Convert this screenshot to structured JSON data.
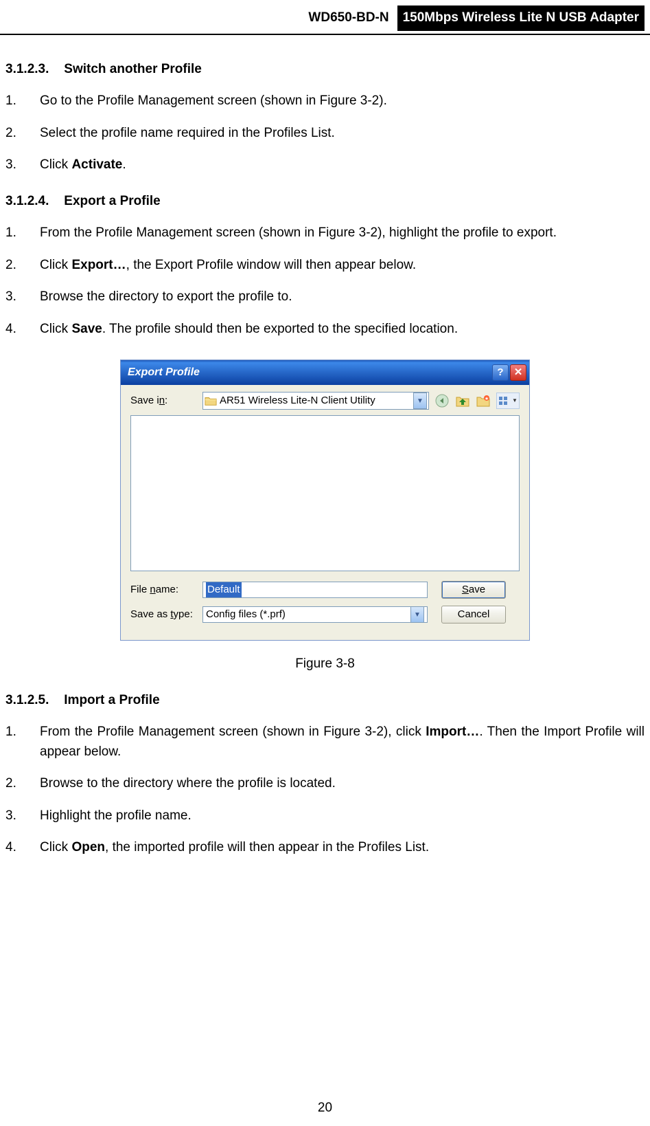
{
  "header": {
    "model": "WD650-BD-N",
    "title": "150Mbps Wireless Lite N USB Adapter"
  },
  "s1": {
    "num": "3.1.2.3.",
    "title": "Switch another Profile"
  },
  "s1steps": {
    "n1": "1.",
    "t1": "Go to the Profile Management screen (shown in Figure 3-2).",
    "n2": "2.",
    "t2": "Select the profile name required in the Profiles List.",
    "n3": "3.",
    "t3a": "Click ",
    "t3b": "Activate",
    "t3c": "."
  },
  "s2": {
    "num": "3.1.2.4.",
    "title": "Export a Profile"
  },
  "s2steps": {
    "n1": "1.",
    "t1": "From the Profile Management screen (shown in Figure 3-2), highlight the profile to export.",
    "n2": "2.",
    "t2a": "Click ",
    "t2b": "Export…",
    "t2c": ", the Export Profile window will then appear below.",
    "n3": "3.",
    "t3": "Browse the directory to export the profile to.",
    "n4": "4.",
    "t4a": "Click ",
    "t4b": "Save",
    "t4c": ". The profile should then be exported to the specified location."
  },
  "dialog": {
    "title": "Export Profile",
    "savein_label": "Save in:",
    "savein_value": "AR51 Wireless Lite-N Client Utility",
    "filename_label": "File name:",
    "filename_value": "Default",
    "filetype_label": "Save as type:",
    "filetype_value": "Config files (*.prf)",
    "save_btn": "ave",
    "save_btn_pre": "S",
    "cancel_btn": "Cancel"
  },
  "figure_caption": "Figure 3-8",
  "s3": {
    "num": "3.1.2.5.",
    "title": "Import a Profile"
  },
  "s3steps": {
    "n1": "1.",
    "t1a": "From the Profile Management screen (shown in Figure 3-2), click ",
    "t1b": "Import…",
    "t1c": ". Then the Import Profile will appear below.",
    "n2": "2.",
    "t2": "Browse to the directory where the profile is located.",
    "n3": "3.",
    "t3": "Highlight the profile name.",
    "n4": "4.",
    "t4a": "Click ",
    "t4b": "Open",
    "t4c": ", the imported profile will then appear in the Profiles List."
  },
  "page_number": "20"
}
